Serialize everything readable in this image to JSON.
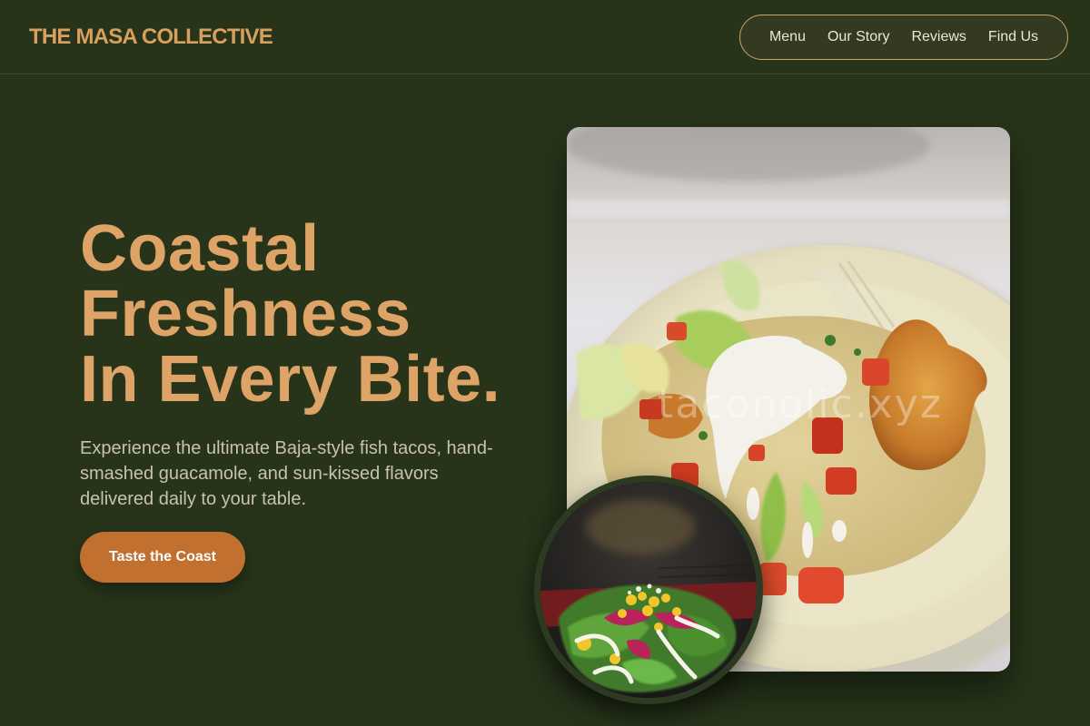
{
  "header": {
    "brand": "THE MASA COLLECTIVE",
    "nav": [
      "Menu",
      "Our Story",
      "Reviews",
      "Find Us"
    ]
  },
  "hero": {
    "title_lines": [
      "Coastal",
      "Freshness",
      "In Every Bite."
    ],
    "subtitle": "Experience the ultimate Baja-style fish tacos, hand-smashed guacamole, and sun-kissed flavors delivered daily to your table.",
    "cta_label": "Taste the Coast"
  },
  "images": {
    "main_watermark": "taconolic.xyz"
  },
  "colors": {
    "background": "#27341a",
    "accent": "#dea366",
    "cta": "#c2702f",
    "nav_border": "#c9a56b"
  }
}
